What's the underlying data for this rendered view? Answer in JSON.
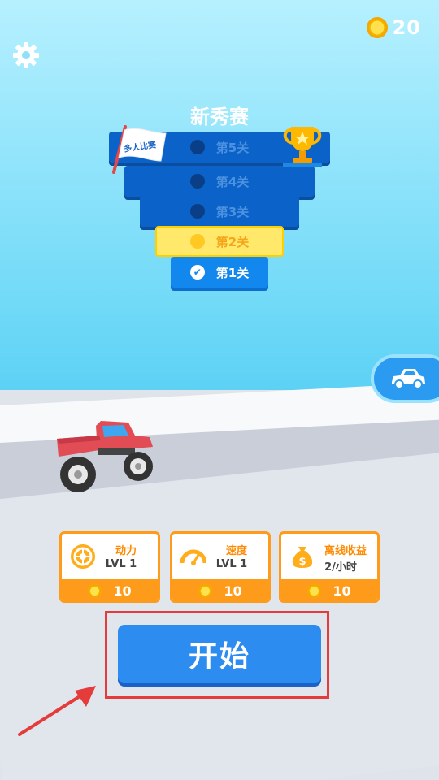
{
  "coins": "20",
  "title": "新秀赛",
  "multiplayer_flag": "多人比赛",
  "levels": [
    {
      "label": "第5关",
      "state": "locked"
    },
    {
      "label": "第4关",
      "state": "locked"
    },
    {
      "label": "第3关",
      "state": "locked"
    },
    {
      "label": "第2关",
      "state": "current"
    },
    {
      "label": "第1关",
      "state": "completed"
    }
  ],
  "upgrades": [
    {
      "name": "动力",
      "level": "LVL 1",
      "cost": "10",
      "icon": "engine-icon"
    },
    {
      "name": "速度",
      "level": "LVL 1",
      "cost": "10",
      "icon": "speedometer-icon"
    },
    {
      "name": "离线收益",
      "level": "2/小时",
      "cost": "10",
      "icon": "money-bag-icon"
    }
  ],
  "start_label": "开始",
  "colors": {
    "primary_blue": "#2d8cf0",
    "orange": "#ff9b1a",
    "highlight_red": "#e53b3b"
  }
}
